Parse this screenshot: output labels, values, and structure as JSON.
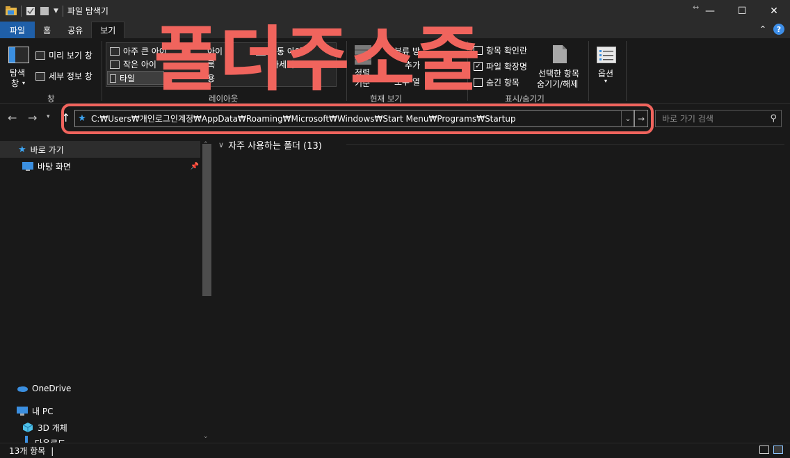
{
  "window": {
    "title": "파일 탐색기",
    "controls": {
      "minimize": "—",
      "maximize": "☐",
      "close": "✕"
    }
  },
  "ribbon_tabs": [
    {
      "label": "파일"
    },
    {
      "label": "홈"
    },
    {
      "label": "공유"
    },
    {
      "label": "보기"
    }
  ],
  "ribbon": {
    "panes": {
      "nav_pane_label": "탐색",
      "nav_pane_label2": "창",
      "preview_label": "미리 보기 창",
      "details_label": "세부 정보 창",
      "group_label": "창"
    },
    "layout": {
      "extra_large": "아주 큰 아이",
      "small": "작은 아이",
      "tiles": "타일",
      "medium": "보통 아이",
      "details": "자세히",
      "col2_r1": "아이",
      "col2_r2": "록",
      "col2_r3": "용",
      "group_label": "레이아웃"
    },
    "current_view": {
      "sort": "정렬",
      "sort2": "기준",
      "group_by": "분류 방",
      "add_cols": "추가",
      "fit_cols": "모두 열",
      "group_label": "현재 보기"
    },
    "show_hide": {
      "item_check": "항목 확인란",
      "extensions": "파일 확장명",
      "hidden": "숨긴 항목",
      "hide_selected_1": "선택한 항목",
      "hide_selected_2": "숨기기/해제",
      "group_label": "표시/숨기기"
    },
    "options": {
      "label": "옵션"
    }
  },
  "address": {
    "path": "C:₩Users₩개인로그인계정₩AppData₩Roaming₩Microsoft₩Windows₩Start Menu₩Programs₩Startup",
    "search_placeholder": "바로 가기 검색"
  },
  "nav_pane": {
    "items": [
      {
        "label": "바로 가기",
        "icon": "star-icon"
      },
      {
        "label": "바탕 화면",
        "icon": "desktop-icon"
      },
      {
        "label": "OneDrive",
        "icon": "cloud-icon"
      },
      {
        "label": "내 PC",
        "icon": "pc-icon"
      },
      {
        "label": "3D 개체",
        "icon": "cube-icon"
      },
      {
        "label": "다운로드",
        "icon": "download-icon"
      }
    ]
  },
  "content": {
    "group_header": "자주 사용하는 폴더 (13)"
  },
  "status": {
    "item_count": "13개 항목",
    "separator": "|"
  },
  "overlay": {
    "text": "폴더주소줄",
    "color": "#f0645d"
  },
  "colors": {
    "file_tab": "#1f5fa8",
    "accent_star": "#3fa7f5",
    "background": "#191919"
  }
}
